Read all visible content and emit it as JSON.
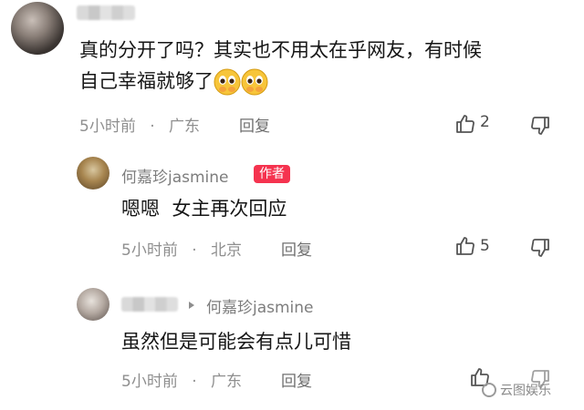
{
  "comments": [
    {
      "author": "",
      "text": "真的分开了吗？其实也不用太在乎网友，有时候",
      "text2": "自己幸福就够了",
      "time": "5小时前",
      "sep": "·",
      "location": "广东",
      "reply": "回复",
      "likes": "2"
    },
    {
      "author": "何嘉珍jasmine",
      "badge": "作者",
      "text": "嗯嗯  女主再次回应",
      "time": "5小时前",
      "sep": "·",
      "location": "北京",
      "reply": "回复",
      "likes": "5"
    },
    {
      "author": "",
      "reply_to": "何嘉珍jasmine",
      "text": "虽然但是可能会有点儿可惜",
      "time": "5小时前",
      "sep": "·",
      "location": "广东",
      "reply": "回复",
      "likes": ""
    }
  ],
  "watermark": "云图娱乐",
  "icons": [
    "thumbs-up-icon",
    "thumbs-down-icon",
    "pleading-face-icon",
    "reply-arrow-icon"
  ]
}
